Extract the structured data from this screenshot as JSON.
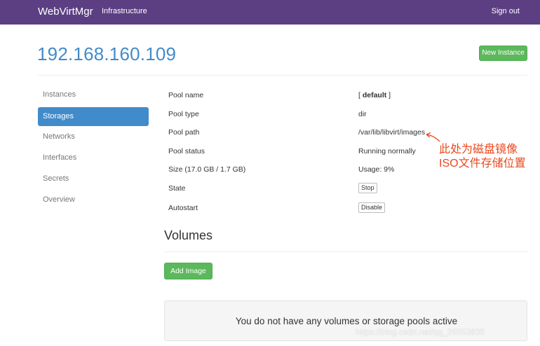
{
  "navbar": {
    "brand": "WebVirtMgr",
    "link": "Infrastructure",
    "signout": "Sign out"
  },
  "host_title": "192.168.160.109",
  "new_instance_label": "New Instance",
  "sidebar": {
    "items": [
      {
        "label": "Instances"
      },
      {
        "label": "Storages"
      },
      {
        "label": "Networks"
      },
      {
        "label": "Interfaces"
      },
      {
        "label": "Secrets"
      },
      {
        "label": "Overview"
      }
    ],
    "active": "Storages"
  },
  "pool": {
    "name_label": "Pool name",
    "name_value": "default",
    "name_bracket_left": "[ ",
    "name_bracket_right": " ]",
    "type_label": "Pool type",
    "type_value": "dir",
    "path_label": "Pool path",
    "path_value": "/var/lib/libvirt/images",
    "status_label": "Pool status",
    "status_value": "Running normally",
    "size_label": "Size (17.0 GB / 1.7 GB)",
    "usage_value": "Usage: 9%",
    "state_label": "State",
    "state_button": "Stop",
    "autostart_label": "Autostart",
    "autostart_button": "Disable"
  },
  "annotation": {
    "line1": "此处为磁盘镜像",
    "line2": "ISO文件存储位置",
    "color": "#e8481c"
  },
  "volumes": {
    "heading": "Volumes",
    "add_button": "Add Image",
    "empty_message": "You do not have any volumes or storage pools active"
  },
  "watermark": "https://blog.csdn.net/qq_26553835",
  "colors": {
    "navbar": "#5c3f82",
    "primary": "#428bca",
    "success": "#5cb85c"
  }
}
